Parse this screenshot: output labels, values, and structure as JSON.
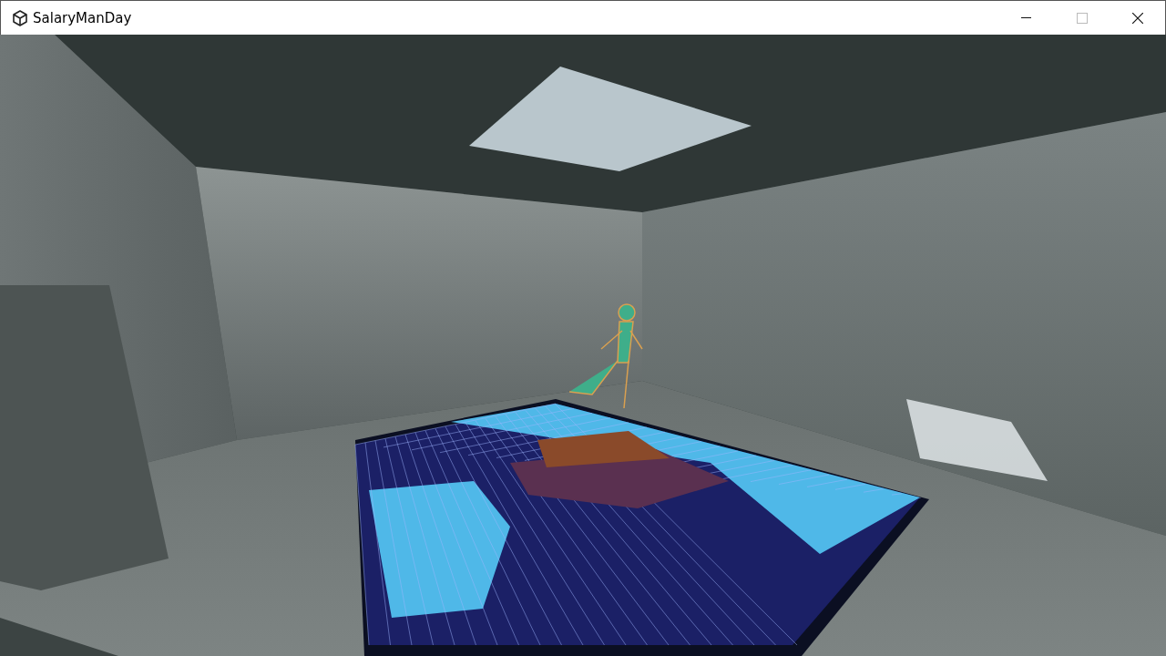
{
  "window": {
    "title": "SalaryManDay"
  }
}
